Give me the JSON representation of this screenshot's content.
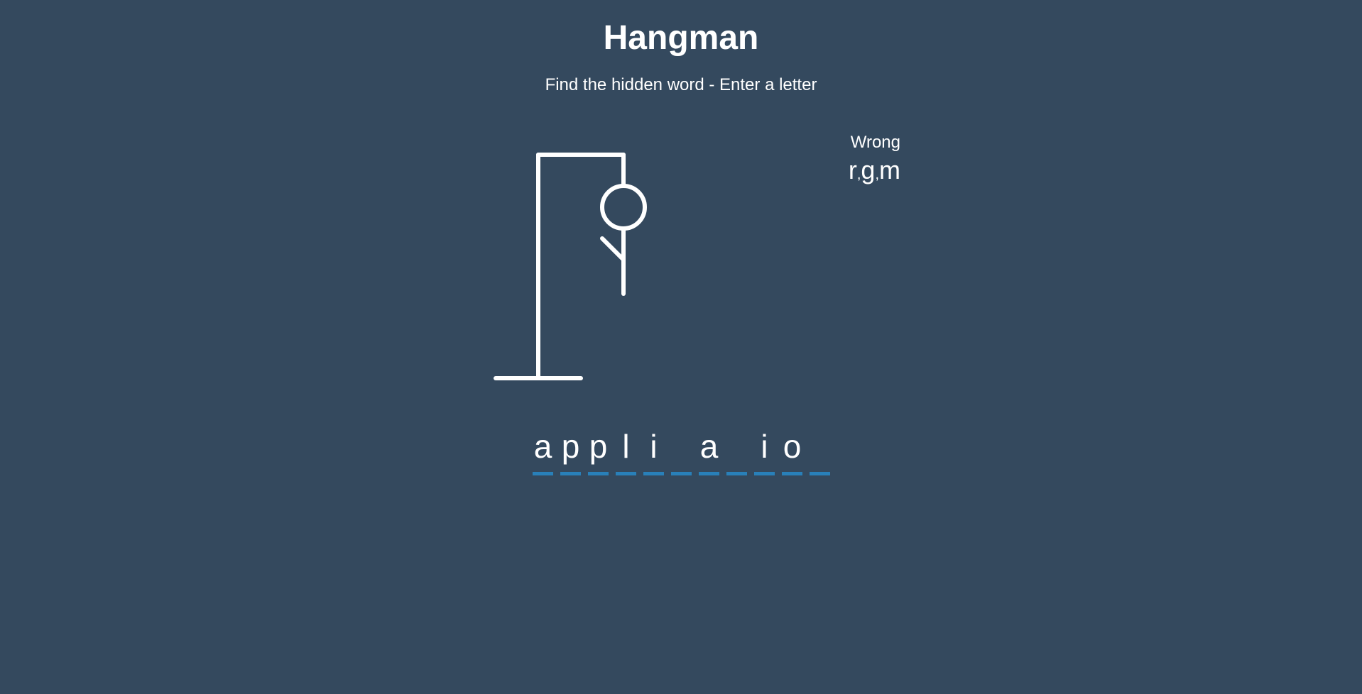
{
  "header": {
    "title": "Hangman",
    "subtitle": "Find the hidden word - Enter a letter"
  },
  "wrong": {
    "label": "Wrong",
    "letters": [
      "r",
      "g",
      "m"
    ],
    "separator": ","
  },
  "word": {
    "slots": [
      "a",
      "p",
      "p",
      "l",
      "i",
      "",
      "a",
      "",
      "i",
      "o",
      ""
    ]
  },
  "figure": {
    "parts_visible": [
      "head",
      "body",
      "left-arm"
    ]
  },
  "colors": {
    "background": "#34495e",
    "text": "#ffffff",
    "slot_underline": "#2980b9"
  }
}
